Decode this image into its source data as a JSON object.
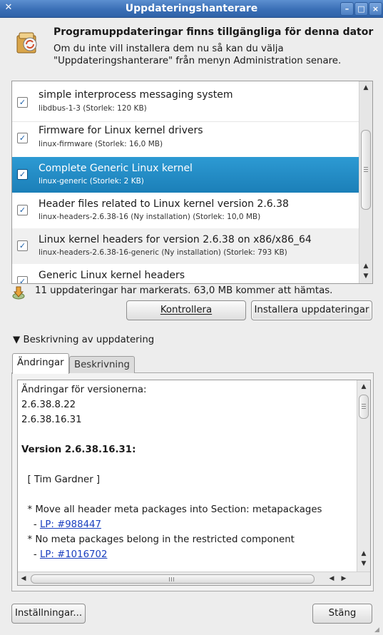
{
  "window": {
    "title": "Uppdateringshanterare",
    "menu_icon": "window-menu-icon",
    "controls": [
      "minimize",
      "maximize",
      "close"
    ]
  },
  "header": {
    "icon": "update-manager-icon",
    "heading": "Programuppdateringar finns tillgängliga för denna dator",
    "text_line1": "Om du inte vill installera dem nu så kan du välja",
    "text_line2": "\"Uppdateringshanterare\" från menyn Administration senare."
  },
  "updates": [
    {
      "title": "simple interprocess messaging system",
      "detail": "libdbus-1-3 (Storlek: 120 KB)",
      "checked": true,
      "selected": false
    },
    {
      "title": "Firmware for Linux kernel drivers",
      "detail": "linux-firmware (Storlek: 16,0 MB)",
      "checked": true,
      "selected": false
    },
    {
      "title": "Complete Generic Linux kernel",
      "detail": "linux-generic (Storlek: 2 KB)",
      "checked": true,
      "selected": true
    },
    {
      "title": "Header files related to Linux kernel version 2.6.38",
      "detail": "linux-headers-2.6.38-16 (Ny installation) (Storlek: 10,0 MB)",
      "checked": true,
      "selected": false
    },
    {
      "title": "Linux kernel headers for version 2.6.38 on x86/x86_64",
      "detail": "linux-headers-2.6.38-16-generic (Ny installation) (Storlek: 793 KB)",
      "checked": true,
      "selected": false
    },
    {
      "title": "Generic Linux kernel headers",
      "detail": "",
      "checked": true,
      "selected": false
    }
  ],
  "status": {
    "icon": "download-arrow-icon",
    "text": "11 uppdateringar har markerats. 63,0 MB kommer att hämtas."
  },
  "buttons": {
    "check": "Kontrollera",
    "install": "Installera uppdateringar",
    "settings": "Inställningar...",
    "close": "Stäng"
  },
  "details": {
    "expander_label": "Beskrivning av uppdatering",
    "expanded": true,
    "tabs": [
      "Ändringar",
      "Beskrivning"
    ],
    "active_tab": 0,
    "changelog": [
      {
        "text": "Ändringar för versionerna:",
        "bold": false
      },
      {
        "text": "2.6.38.8.22",
        "bold": false
      },
      {
        "text": "2.6.38.16.31",
        "bold": false
      },
      {
        "text": "",
        "bold": false
      },
      {
        "text": "Version 2.6.38.16.31:",
        "bold": true
      },
      {
        "text": "",
        "bold": false
      },
      {
        "text": "  [ Tim Gardner ]",
        "bold": false
      },
      {
        "text": "",
        "bold": false
      },
      {
        "text": "  * Move all header meta packages into Section: metapackages",
        "bold": false
      },
      {
        "prefix": "    - ",
        "link": "LP: #988447",
        "bold": false
      },
      {
        "text": "  * No meta packages belong in the restricted component",
        "bold": false
      },
      {
        "prefix": "    - ",
        "link": "LP: #1016702",
        "bold": false
      }
    ]
  }
}
